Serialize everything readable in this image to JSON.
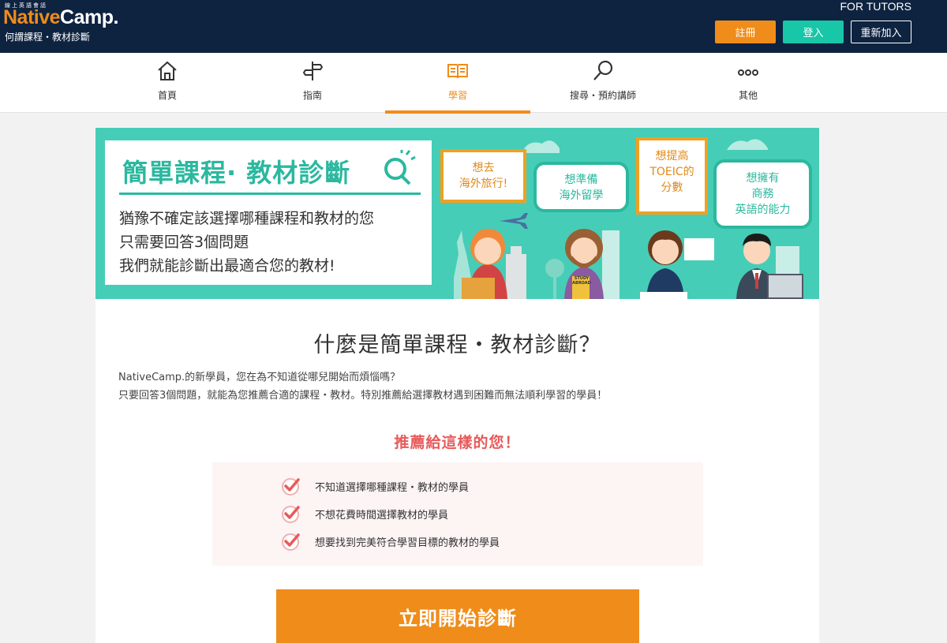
{
  "header": {
    "logo_small": "線上英語會話",
    "logo_native": "Native",
    "logo_camp": "Camp.",
    "page_subtitle": "何謂課程・教材診斷",
    "for_tutors": "FOR TUTORS",
    "register_label": "註冊",
    "login_label": "登入",
    "rejoin_label": "重新加入",
    "colors": {
      "navy": "#0e2340",
      "orange": "#f08c1a",
      "teal": "#18c6a8"
    }
  },
  "nav": {
    "items": [
      {
        "label": "首頁",
        "icon": "home-icon"
      },
      {
        "label": "指南",
        "icon": "signpost-icon"
      },
      {
        "label": "學習",
        "icon": "book-icon",
        "active": true
      },
      {
        "label": "搜尋・預約講師",
        "icon": "search-icon"
      },
      {
        "label": "其他",
        "icon": "more-icon"
      }
    ]
  },
  "banner": {
    "title": "簡單課程· 教材診斷",
    "lines": [
      "猶豫不確定該選擇哪種課程和教材的您",
      "只需要回答3個問題",
      "我們就能診斷出最適合您的教材!"
    ],
    "bubbles": [
      {
        "line1": "想去",
        "line2": "海外旅行!"
      },
      {
        "line1": "想準備",
        "line2": "海外留學"
      },
      {
        "line1": "想提高",
        "line2": "TOEIC的",
        "line3": "分數"
      },
      {
        "line1": "想擁有",
        "line2": "商務",
        "line3": "英語的能力"
      }
    ],
    "book_text": "STUDY ABROAD"
  },
  "main": {
    "heading": "什麼是簡單課程・教材診斷？",
    "intro_1": "NativeCamp.的新學員，您在為不知道從哪兒開始而煩惱嗎？",
    "intro_2": "只要回答3個問題，就能為您推薦合適的課程・教材。特別推薦給選擇教材遇到困難而無法順利學習的學員！",
    "recommend_title": "推薦給這樣的您！",
    "recommend_items": [
      "不知道選擇哪種課程・教材的學員",
      "不想花費時間選擇教材的學員",
      "想要找到完美符合學習目標的教材的學員"
    ],
    "start_button": "立即開始診斷"
  }
}
